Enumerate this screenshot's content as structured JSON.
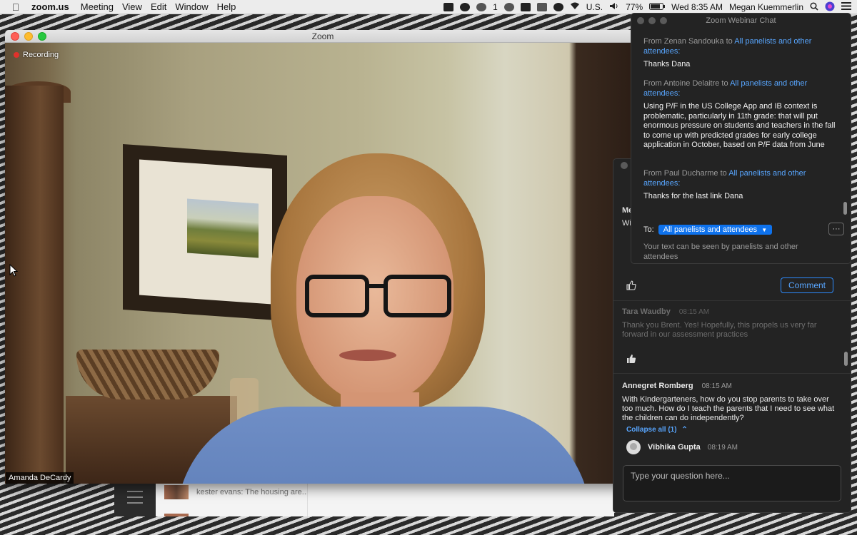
{
  "menubar": {
    "apple": "",
    "app": "zoom.us",
    "menus": [
      "Meeting",
      "View",
      "Edit",
      "Window",
      "Help"
    ],
    "badge": "1",
    "input_source": "U.S.",
    "battery": "77%",
    "clock": "Wed 8:35 AM",
    "user": "Megan Kuemmerlin"
  },
  "zoom_window": {
    "title": "Zoom",
    "recording_label": "Recording",
    "participant_name": "Amanda DeCardy"
  },
  "background_window": {
    "note": "kester evans: The housing are..."
  },
  "chat": {
    "title": "Zoom Webinar Chat",
    "messages": [
      {
        "from_prefix": "From Zenan Sandouka to ",
        "to": "All panelists and other attendees:",
        "body": "Thanks Dana"
      },
      {
        "from_prefix": "From Antoine Delaitre to ",
        "to": "All panelists and other attendees:",
        "body": "Using P/F in the US College App and IB context is problematic, particularly in 11th grade: that will put enormous pressure on students and teachers in the fall to come up with predicted grades for early college application in October, based on P/F data from June"
      },
      {
        "from_prefix": "From Paul Ducharme to ",
        "to": "All panelists and other attendees:",
        "body": "Thanks for the last link Dana"
      }
    ],
    "to_label": "To:",
    "to_value": "All panelists and attendees",
    "more_label": "···",
    "notice": "Your text can be seen by panelists and other attendees"
  },
  "qa": {
    "partial_text_1": "Me",
    "partial_text_2": "Wi",
    "comment_label": "Comment",
    "questions": [
      {
        "name": "Tara Waudby",
        "time": "08:15 AM",
        "text": "Thank you Brent.  Yes!  Hopefully, this propels us very far forward in our assessment practices",
        "dimmed": true
      },
      {
        "name": "Annegret Romberg",
        "time": "08:15 AM",
        "text": "With Kindergarteners, how do you stop parents to take over too much. How do I teach the parents that I need to see what the children can do independently?",
        "dimmed": false
      }
    ],
    "collapse_label": "Collapse all (1)",
    "reply": {
      "name": "Vibhika Gupta",
      "time": "08:19 AM"
    },
    "input_placeholder": "Type your question here..."
  },
  "colors": {
    "accent_blue": "#0e72ed",
    "link_blue": "#58a6ff",
    "recording_red": "#e0312b",
    "panel_bg": "#232323"
  },
  "icons": [
    "apple-icon",
    "zoom-icon",
    "skype-icon",
    "wechat-icon",
    "wifi-icon",
    "volume-icon",
    "search-icon",
    "siri-icon",
    "menu-icon",
    "thumbs-up-icon",
    "chevron-up-icon",
    "caret-down-icon"
  ]
}
